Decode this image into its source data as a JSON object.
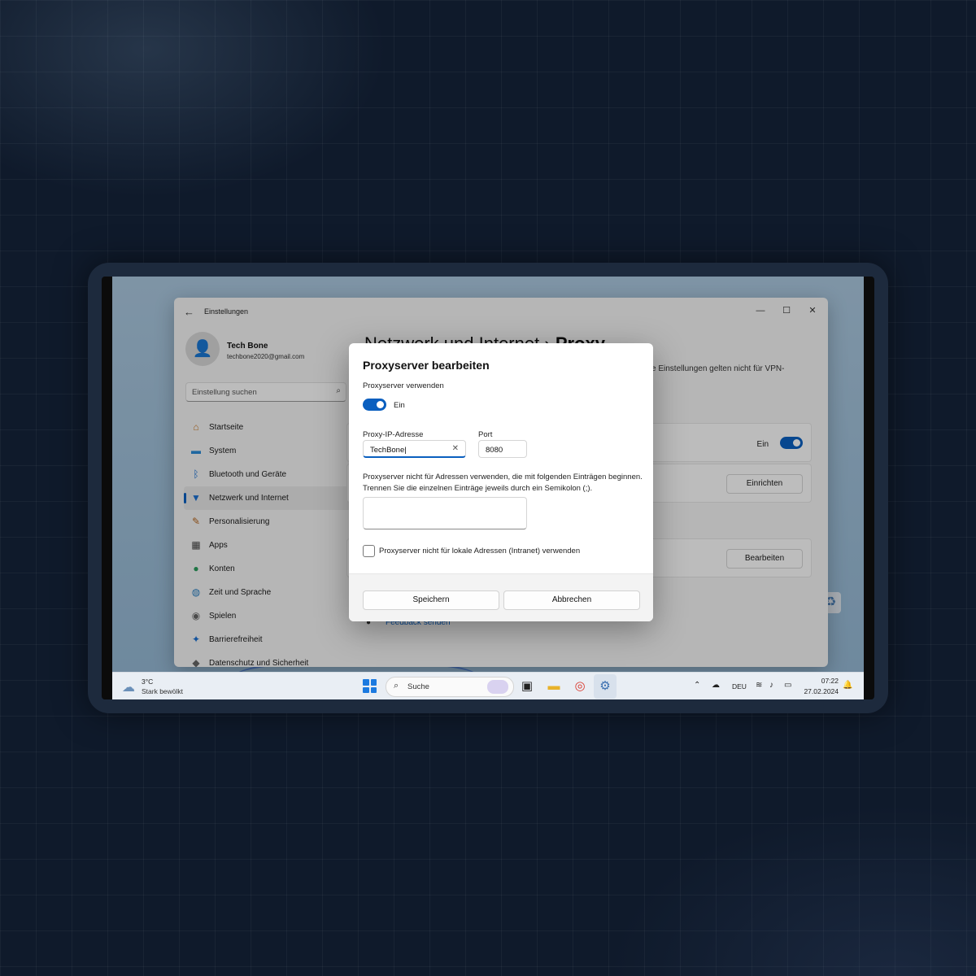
{
  "settings_window": {
    "title": "Einstellungen",
    "controls": {
      "minimize": "—",
      "maximize": "☐",
      "close": "✕"
    },
    "profile": {
      "name": "Tech Bone",
      "email": "techbone2020@gmail.com"
    },
    "search_placeholder": "Einstellung suchen",
    "nav_items": [
      {
        "label": "Startseite",
        "icon": "home-icon"
      },
      {
        "label": "System",
        "icon": "system-icon"
      },
      {
        "label": "Bluetooth und Geräte",
        "icon": "bluetooth-icon"
      },
      {
        "label": "Netzwerk und Internet",
        "icon": "wifi-icon",
        "active": true
      },
      {
        "label": "Personalisierung",
        "icon": "brush-icon"
      },
      {
        "label": "Apps",
        "icon": "apps-icon"
      },
      {
        "label": "Konten",
        "icon": "account-icon"
      },
      {
        "label": "Zeit und Sprache",
        "icon": "globe-icon"
      },
      {
        "label": "Spielen",
        "icon": "gamepad-icon"
      },
      {
        "label": "Barrierefreiheit",
        "icon": "accessibility-icon"
      },
      {
        "label": "Datenschutz und Sicherheit",
        "icon": "shield-icon"
      }
    ],
    "content": {
      "breadcrumb_parent": "Netzwerk und Internet",
      "breadcrumb_sep": "›",
      "breadcrumb_current": "Proxy",
      "description_fragment": "e Einstellungen gelten nicht für VPN-",
      "auto_detect_state": "Ein",
      "setup_button": "Einrichten",
      "edit_button": "Bearbeiten",
      "feedback_link": "Feedback senden"
    }
  },
  "dialog": {
    "title": "Proxyserver bearbeiten",
    "use_proxy_label": "Proxyserver verwenden",
    "toggle_state": "Ein",
    "ip_label": "Proxy-IP-Adresse",
    "ip_value": "TechBone",
    "port_label": "Port",
    "port_value": "8080",
    "exceptions_text": "Proxyserver nicht für Adressen verwenden, die mit folgenden Einträgen beginnen. Trennen Sie die einzelnen Einträge jeweils durch ein Semikolon (;).",
    "exceptions_value": "",
    "local_checkbox_label": "Proxyserver nicht für lokale Adressen (Intranet) verwenden",
    "local_checkbox_checked": false,
    "save_button": "Speichern",
    "cancel_button": "Abbrechen"
  },
  "taskbar": {
    "temperature": "3°C",
    "weather": "Stark bewölkt",
    "search_label": "Suche",
    "language": "DEU",
    "time": "07:22",
    "date": "27.02.2024"
  },
  "colors": {
    "accent": "#0a5fbf",
    "background": "#0f1a2b"
  }
}
